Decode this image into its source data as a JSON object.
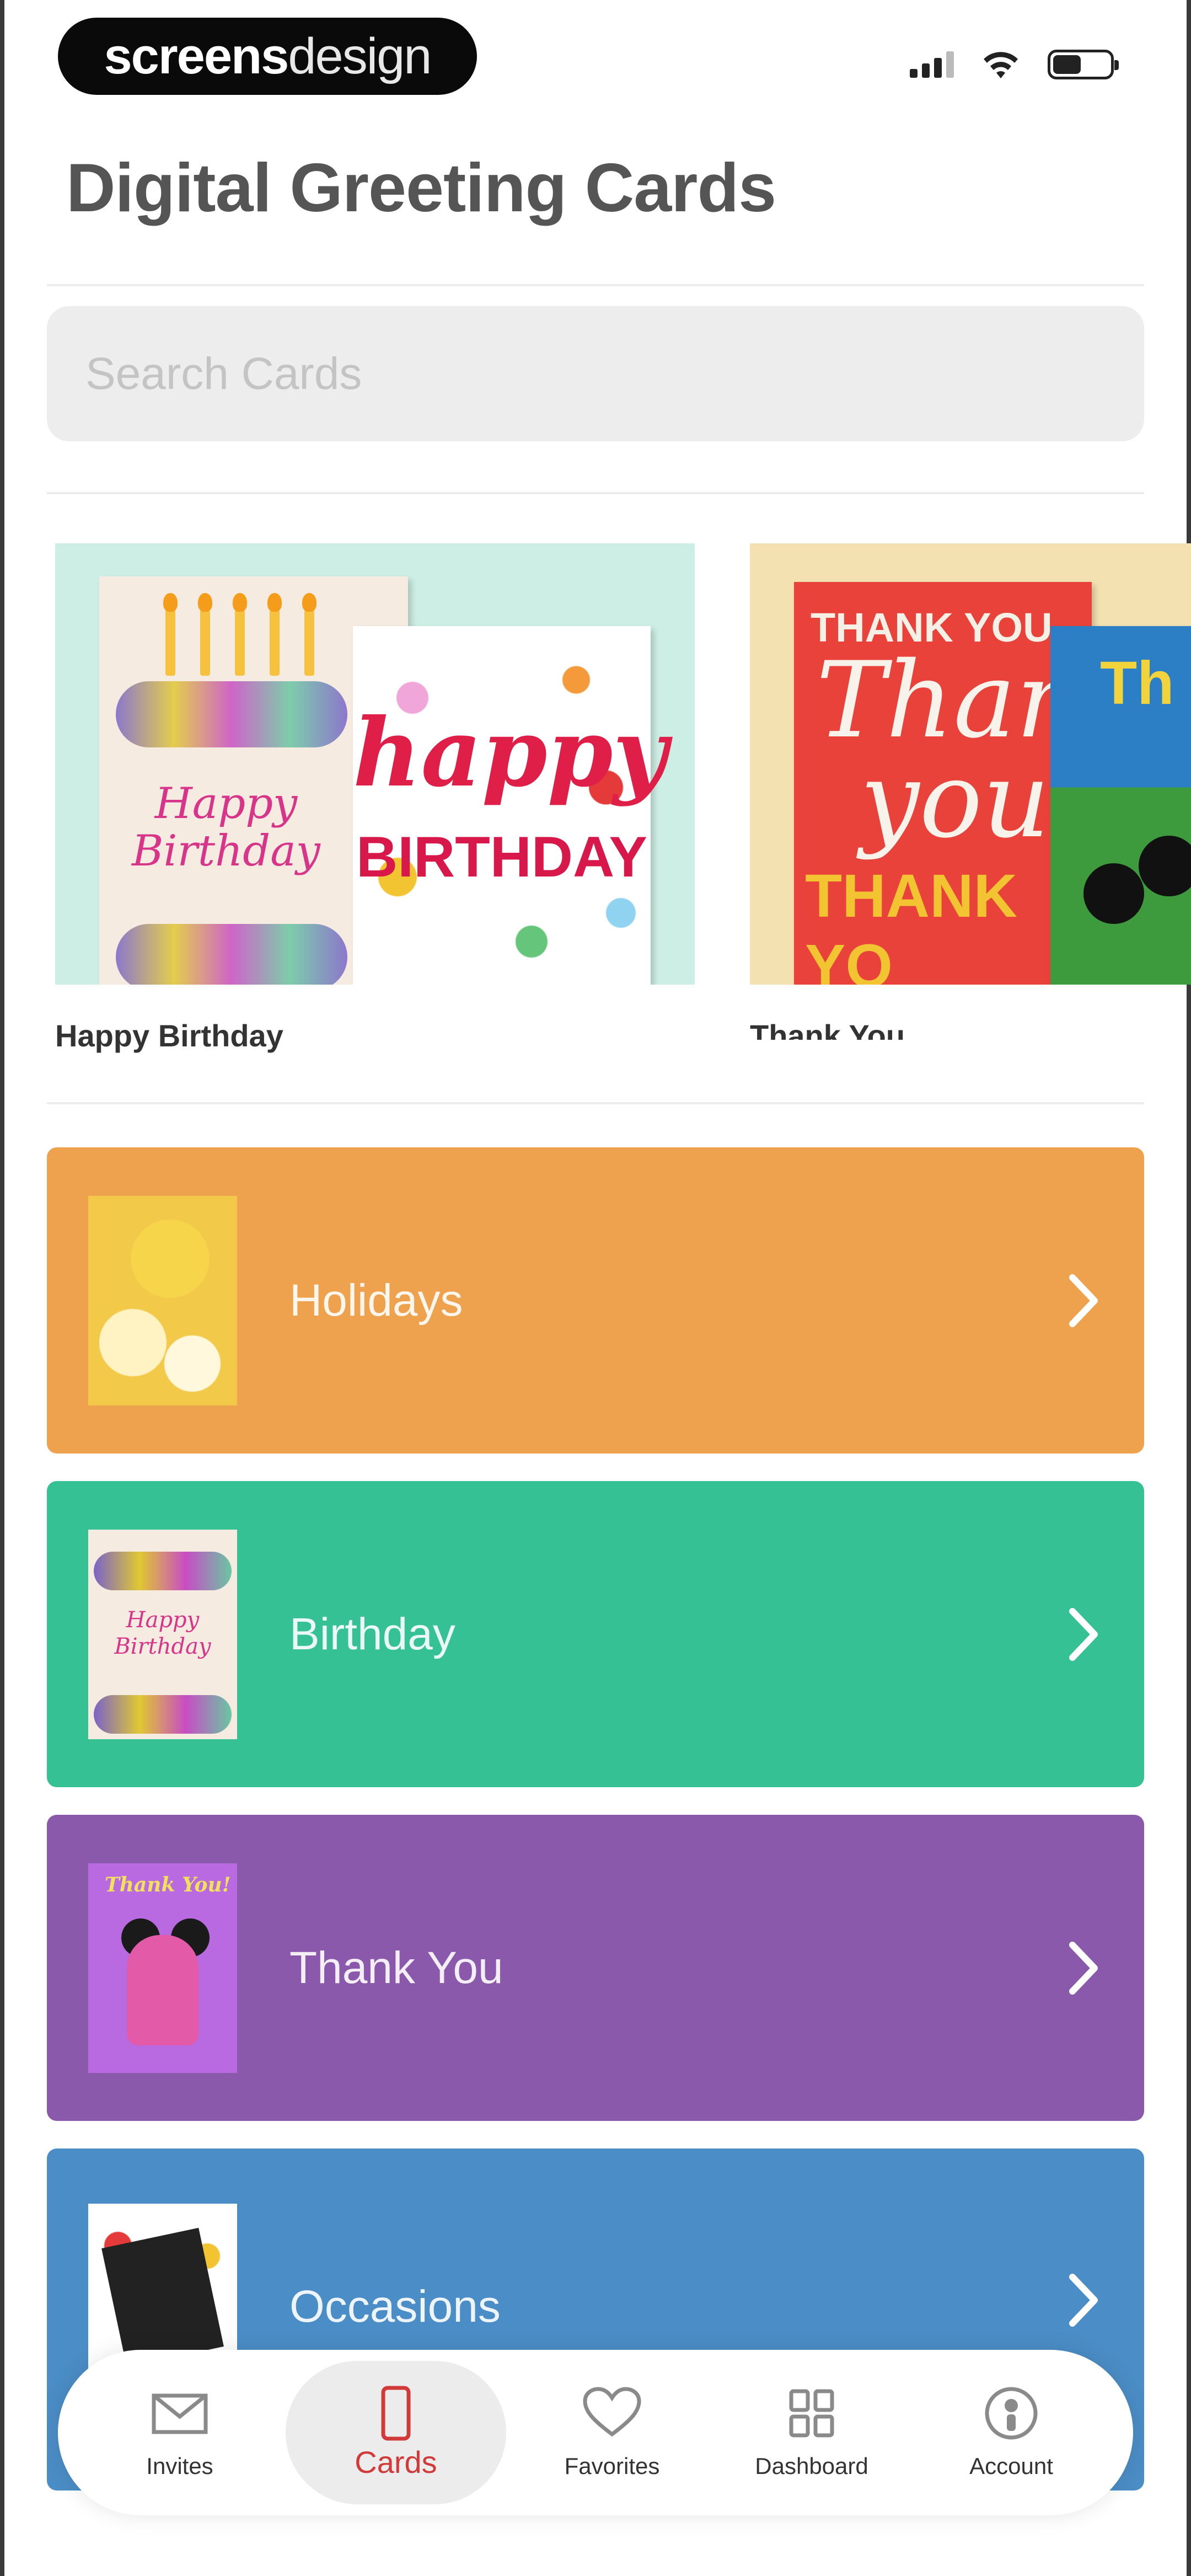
{
  "brand": {
    "bold": "screens",
    "light": "design"
  },
  "page": {
    "title": "Digital Greeting Cards"
  },
  "search": {
    "placeholder": "Search Cards"
  },
  "featured": [
    {
      "label": "Happy Birthday",
      "card_front_text": "Happy Birthday",
      "card_inner_script": "happy",
      "card_inner_block": "BIRTHDAY"
    },
    {
      "label": "Thank You",
      "card_top": "THANK YOU",
      "card_script_1": "Thank",
      "card_script_2": "you",
      "card_bottom": "THANK YO",
      "second_card_text": "Th Yo"
    }
  ],
  "categories": [
    {
      "label": "Holidays",
      "color": "#eea24e",
      "thumb_text": ""
    },
    {
      "label": "Birthday",
      "color": "#35c194",
      "thumb_text": "Happy Birthday"
    },
    {
      "label": "Thank You",
      "color": "#8b59ac",
      "thumb_text": "Thank You!"
    },
    {
      "label": "Occasions",
      "color": "#4b8dc6",
      "thumb_text": ""
    }
  ],
  "tabbar": {
    "active": "Cards",
    "tabs": [
      {
        "label": "Invites",
        "icon": "envelope-icon"
      },
      {
        "label": "Cards",
        "icon": "phone-card-icon"
      },
      {
        "label": "Favorites",
        "icon": "heart-icon"
      },
      {
        "label": "Dashboard",
        "icon": "grid-icon"
      },
      {
        "label": "Account",
        "icon": "person-icon"
      }
    ]
  },
  "colors": {
    "accent": "#d23a3a",
    "title": "#555555"
  }
}
